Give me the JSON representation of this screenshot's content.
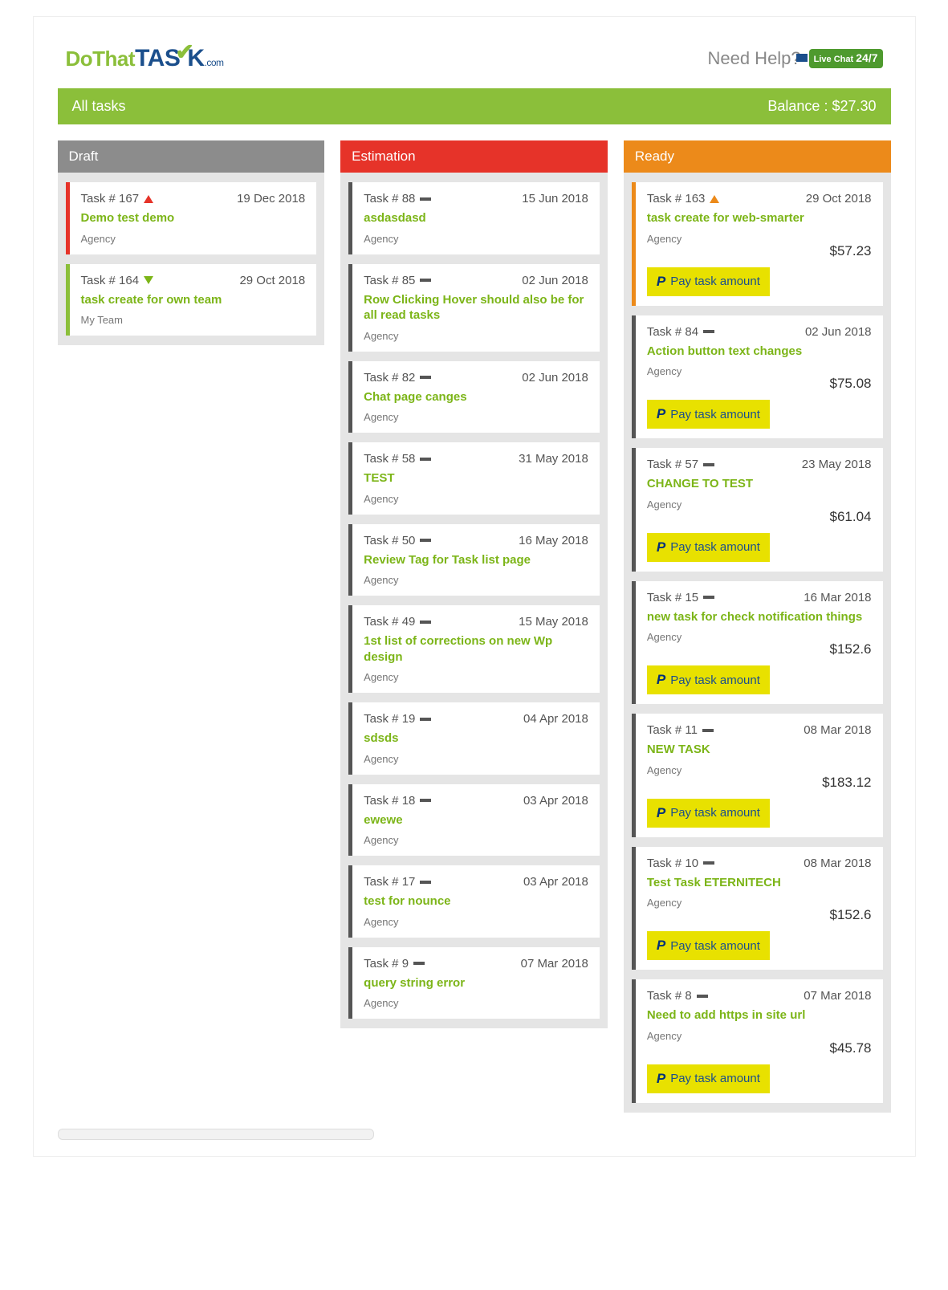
{
  "header": {
    "logo_do": "Do",
    "logo_that": "That",
    "logo_task": "TAS",
    "logo_k": "K",
    "logo_com": ".com",
    "help": "Need Help?",
    "chat_line1": "Live",
    "chat_line2": "Chat",
    "chat_big": "24/7"
  },
  "titlebar": {
    "title": "All tasks",
    "balance": "Balance : $27.30"
  },
  "columns": {
    "draft": {
      "label": "Draft"
    },
    "estimation": {
      "label": "Estimation"
    },
    "ready": {
      "label": "Ready"
    }
  },
  "pay_label": "Pay task amount",
  "draft": [
    {
      "num": "Task # 167",
      "icon": "tri-up-red",
      "date": "19 Dec 2018",
      "title": "Demo test demo",
      "sub": "Agency",
      "border": "red-border"
    },
    {
      "num": "Task # 164",
      "icon": "tri-down-green",
      "date": "29 Oct 2018",
      "title": "task create for own team",
      "sub": "My Team",
      "border": "green-border"
    }
  ],
  "estimation": [
    {
      "num": "Task # 88",
      "icon": "bar-gray",
      "date": "15 Jun 2018",
      "title": "asdasdasd",
      "sub": "Agency"
    },
    {
      "num": "Task # 85",
      "icon": "bar-gray",
      "date": "02 Jun 2018",
      "title": "Row Clicking Hover should also be for all read tasks",
      "sub": "Agency"
    },
    {
      "num": "Task # 82",
      "icon": "bar-gray",
      "date": "02 Jun 2018",
      "title": "Chat page canges",
      "sub": "Agency"
    },
    {
      "num": "Task # 58",
      "icon": "bar-gray",
      "date": "31 May 2018",
      "title": "TEST",
      "sub": "Agency"
    },
    {
      "num": "Task # 50",
      "icon": "bar-gray",
      "date": "16 May 2018",
      "title": "Review Tag for Task list page",
      "sub": "Agency"
    },
    {
      "num": "Task # 49",
      "icon": "bar-gray",
      "date": "15 May 2018",
      "title": "1st list of corrections on new Wp design",
      "sub": "Agency"
    },
    {
      "num": "Task # 19",
      "icon": "bar-gray",
      "date": "04 Apr 2018",
      "title": "sdsds",
      "sub": "Agency"
    },
    {
      "num": "Task # 18",
      "icon": "bar-gray",
      "date": "03 Apr 2018",
      "title": "ewewe",
      "sub": "Agency"
    },
    {
      "num": "Task # 17",
      "icon": "bar-gray",
      "date": "03 Apr 2018",
      "title": "test for nounce",
      "sub": "Agency"
    },
    {
      "num": "Task # 9",
      "icon": "bar-gray",
      "date": "07 Mar 2018",
      "title": "query string error",
      "sub": "Agency"
    }
  ],
  "ready": [
    {
      "num": "Task # 163",
      "icon": "tri-up-orange",
      "date": "29 Oct 2018",
      "title": "task create for web-smarter",
      "sub": "Agency",
      "price": "$57.23",
      "border": "orange-border"
    },
    {
      "num": "Task # 84",
      "icon": "bar-gray",
      "date": "02 Jun 2018",
      "title": "Action button text changes",
      "sub": "Agency",
      "price": "$75.08"
    },
    {
      "num": "Task # 57",
      "icon": "bar-gray",
      "date": "23 May 2018",
      "title": "CHANGE TO TEST",
      "sub": "Agency",
      "price": "$61.04"
    },
    {
      "num": "Task # 15",
      "icon": "bar-gray",
      "date": "16 Mar 2018",
      "title": "new task for check notification things",
      "sub": "Agency",
      "price": "$152.6"
    },
    {
      "num": "Task # 11",
      "icon": "bar-gray",
      "date": "08 Mar 2018",
      "title": "NEW TASK",
      "sub": "Agency",
      "price": "$183.12"
    },
    {
      "num": "Task # 10",
      "icon": "bar-gray",
      "date": "08 Mar 2018",
      "title": "Test Task ETERNITECH",
      "sub": "Agency",
      "price": "$152.6"
    },
    {
      "num": "Task # 8",
      "icon": "bar-gray",
      "date": "07 Mar 2018",
      "title": "Need to add https in site url",
      "sub": "Agency",
      "price": "$45.78"
    }
  ]
}
